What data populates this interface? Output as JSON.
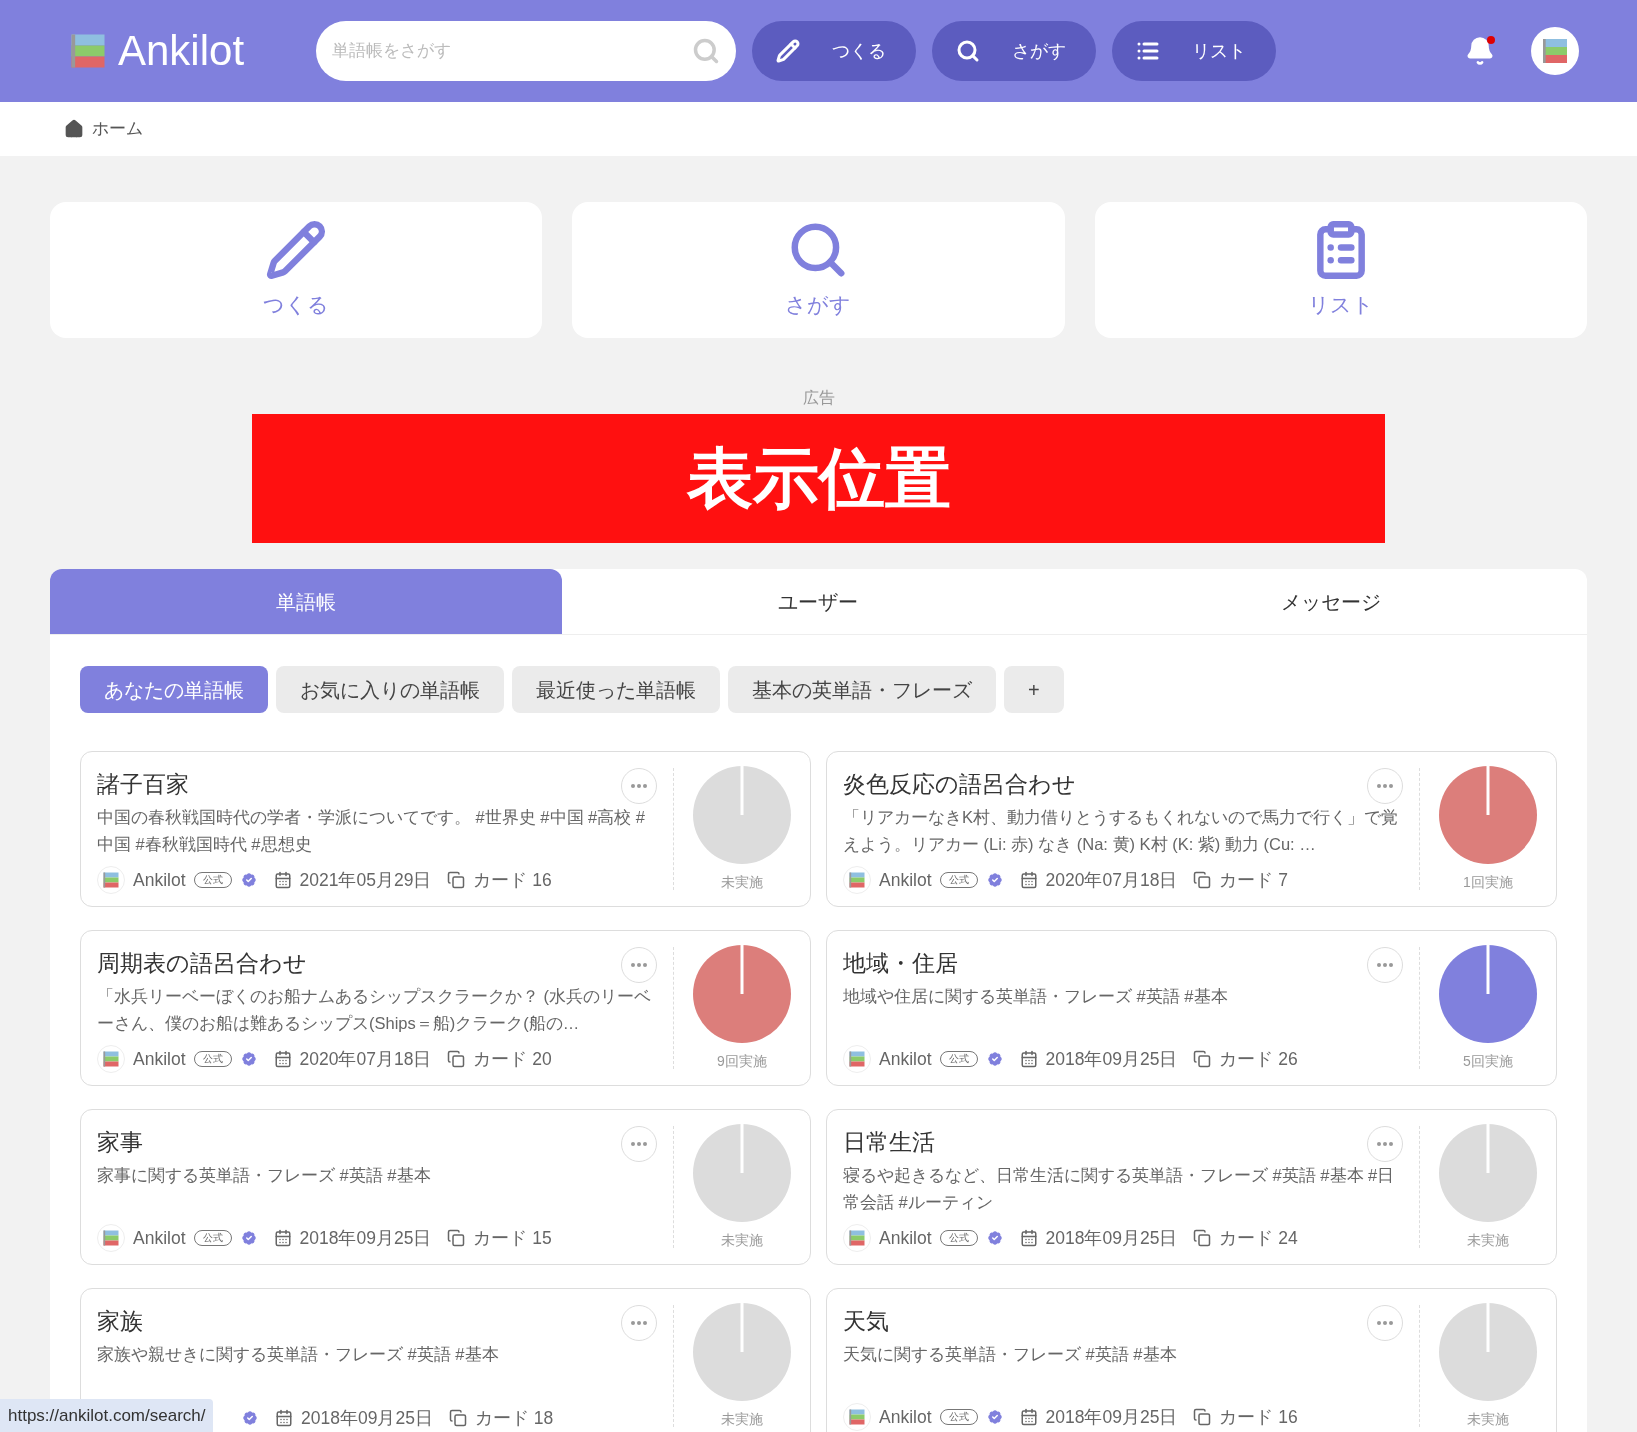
{
  "header": {
    "logo": "Ankilot",
    "search": {
      "placeholder": "単語帳をさがす"
    },
    "nav": [
      {
        "kind": "create",
        "label": "つくる"
      },
      {
        "kind": "search",
        "label": "さがす"
      },
      {
        "kind": "list",
        "label": "リスト"
      }
    ],
    "notification": {
      "unread": true
    }
  },
  "breadcrumb": [
    {
      "kind": "home",
      "label": "ホーム"
    }
  ],
  "quick_actions": [
    {
      "kind": "create",
      "label": "つくる"
    },
    {
      "kind": "search",
      "label": "さがす"
    },
    {
      "kind": "list",
      "label": "リスト"
    }
  ],
  "ad": {
    "label": "広告",
    "banner": "表示位置"
  },
  "tabs": [
    {
      "label": "単語帳",
      "selected": true
    },
    {
      "label": "ユーザー",
      "selected": false
    },
    {
      "label": "メッセージ",
      "selected": false
    }
  ],
  "filters": [
    {
      "label": "あなたの単語帳",
      "selected": true
    },
    {
      "label": "お気に入りの単語帳",
      "selected": false
    },
    {
      "label": "最近使った単語帳",
      "selected": false
    },
    {
      "label": "基本の英単語・フレーズ",
      "selected": false
    },
    {
      "label": "+",
      "selected": false
    }
  ],
  "decks": [
    {
      "title": "諸子百家",
      "description": "中国の春秋戦国時代の学者・学派についてです。 #世界史 #中国 #高校 #中国 #春秋戦国時代 #思想史",
      "author": "Ankilot",
      "badge": "公式",
      "date": "2021年05月29日",
      "cards": "カード 16",
      "progress": "未実施",
      "color": "#dcdcdc"
    },
    {
      "title": "炎色反応の語呂合わせ",
      "description": "「リアカーなきK村、動力借りとうするもくれないので馬力で行く」で覚えよう。リアカー (Li: 赤) なき (Na: 黄) K村 (K: 紫) 動力 (Cu: …",
      "author": "Ankilot",
      "badge": "公式",
      "date": "2020年07月18日",
      "cards": "カード 7",
      "progress": "1回実施",
      "color": "#dc7e7b"
    },
    {
      "title": "周期表の語呂合わせ",
      "description": "「水兵リーベーぼくのお船ナムあるシップスクラークか？ (水兵のリーベーさん、僕のお船は難あるシップス(Ships＝船)クラーク(船の…",
      "author": "Ankilot",
      "badge": "公式",
      "date": "2020年07月18日",
      "cards": "カード 20",
      "progress": "9回実施",
      "color": "#dc7e7b"
    },
    {
      "title": "地域・住居",
      "description": "地域や住居に関する英単語・フレーズ #英語 #基本",
      "author": "Ankilot",
      "badge": "公式",
      "date": "2018年09月25日",
      "cards": "カード 26",
      "progress": "5回実施",
      "color": "#8080dd"
    },
    {
      "title": "家事",
      "description": "家事に関する英単語・フレーズ #英語 #基本",
      "author": "Ankilot",
      "badge": "公式",
      "date": "2018年09月25日",
      "cards": "カード 15",
      "progress": "未実施",
      "color": "#dcdcdc"
    },
    {
      "title": "日常生活",
      "description": "寝るや起きるなど、日常生活に関する英単語・フレーズ #英語 #基本 #日常会話 #ルーティン",
      "author": "Ankilot",
      "badge": "公式",
      "date": "2018年09月25日",
      "cards": "カード 24",
      "progress": "未実施",
      "color": "#dcdcdc"
    },
    {
      "title": "家族",
      "description": "家族や親せきに関する英単語・フレーズ #英語 #基本",
      "date": "2018年09月25日",
      "cards": "カード 18",
      "progress": "未実施",
      "color": "#dcdcdc"
    },
    {
      "title": "天気",
      "description": "天気に関する英単語・フレーズ #英語 #基本",
      "author": "Ankilot",
      "badge": "公式",
      "date": "2018年09月25日",
      "cards": "カード 16",
      "progress": "未実施",
      "color": "#dcdcdc"
    }
  ],
  "status_bar": "https://ankilot.com/search/"
}
